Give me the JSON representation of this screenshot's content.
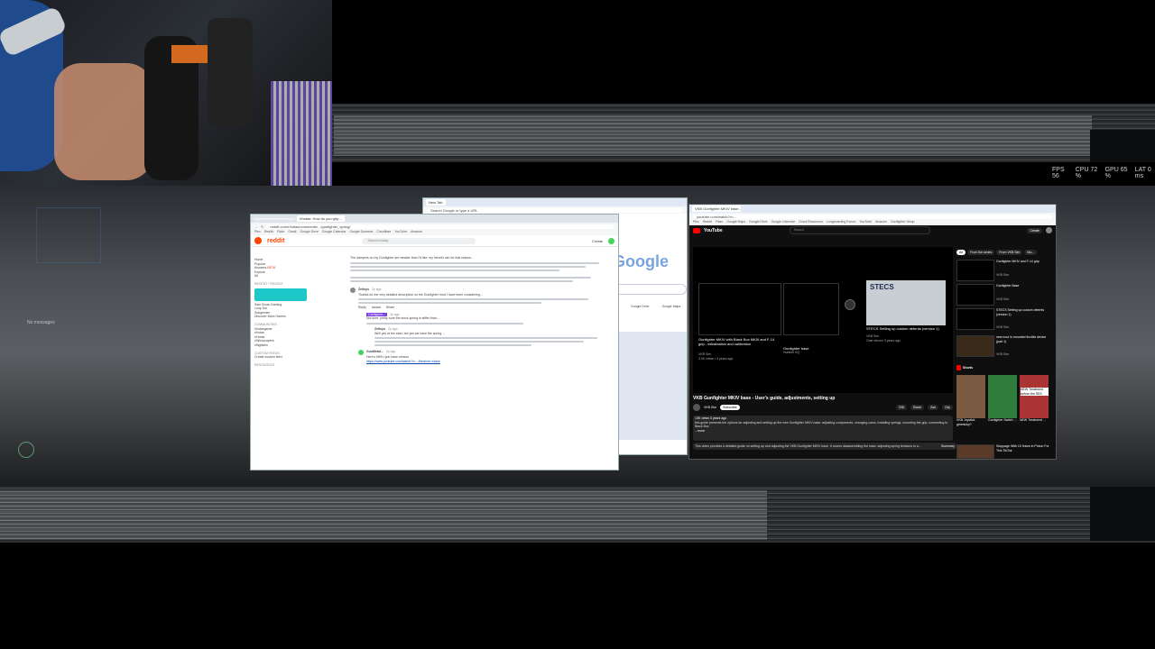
{
  "overlay": {
    "stats": [
      "FPS 56",
      "CPU 72 %",
      "GPU 65 %",
      "LAT 0 ms"
    ],
    "no_messages": "No messages"
  },
  "reddit_window": {
    "tabs": [
      "",
      "r/hotas: How do you grip..."
    ],
    "url": "reddit.com/r/hotas/comments/.../gunfighter_spring/",
    "bookmarks": [
      "Plex",
      "Reddit",
      "Flickr",
      "Gmail",
      "Google Drive",
      "Google Calendar",
      "Google Domains",
      "Cloudflare",
      "YouTube",
      "Amazon"
    ],
    "logo": "reddit",
    "search_placeholder": "Search r/hotas",
    "header_actions": [
      "Create"
    ],
    "sidebar": {
      "nav": [
        "Home",
        "Popular",
        "Answers",
        "Explore",
        "All"
      ],
      "answers_badge": "BETA",
      "recent_label": "RECENT / RECENT",
      "recent": [
        "Sam Snow Gaming",
        "Loop Dol",
        "Subgender",
        "Discover More Games"
      ],
      "communities_label": "COMMUNITIES",
      "communities": [
        "r/hotasgame",
        "r/hotas",
        "r/Hotas",
        "r/Winscrapers",
        "r/flightsim"
      ],
      "custom_feeds_label": "CUSTOM FEEDS",
      "custom_feeds": [
        "Create custom feed"
      ],
      "resources_label": "RESOURCES"
    },
    "comments": [
      {
        "user": "",
        "age": "",
        "text": "The dampers on my Gunfighter are weaker than I'd like; my friend's sim for that reason..."
      },
      {
        "user": "Zeltsys",
        "age": "2y ago",
        "text": "Thanks for the very detailed description on the Gunfighter mod I have been considering..."
      },
      {
        "user": "Gunfighter...",
        "age": "2y ago",
        "text": "Not sure; pretty sure the stock spring is stiffer than..."
      },
      {
        "user": "Zeltsys",
        "age": "2y ago",
        "text": "Well yes at the start, but yes we have the spring ..."
      },
      {
        "user": "GunMetal...",
        "age": "2y ago",
        "text": "Here's MKIV gun base version"
      }
    ],
    "link": "https://www.youtube.com/watch?v=...&feature=share",
    "comment_actions": [
      "Reply",
      "Award",
      "Share"
    ]
  },
  "google_window": {
    "tab": "New Tab",
    "search_placeholder": "Search Google or type a URL",
    "logo": "Google",
    "shortcuts": [
      "Google Drive",
      "Google Maps"
    ]
  },
  "youtube_window": {
    "tab": "VKB Gunfighter MKIV base...",
    "url": "youtube.com/watch?v=...",
    "bookmarks": [
      "Plex",
      "Reddit",
      "Flickr",
      "Google Maps",
      "Google Drive",
      "Google Calendar",
      "Cloud Resources",
      "Longboarding Forum",
      "YouTube",
      "Amazon",
      "Gunfighter Setup"
    ],
    "logo": "YouTube",
    "search_placeholder": "Search",
    "create_label": "Create",
    "player_cards": [
      {
        "title": "Gunfighter MKIV with Black Box MKIII and F-14 grip - initialization and calibration",
        "channel": "VKB Sim",
        "meta": "3.3K views • 3 years ago"
      },
      {
        "title": "Gunfighter base",
        "channel": "Hubbell HQ",
        "meta": ""
      },
      {
        "title": "STECS Setting up custom detents (version 1)",
        "channel": "VKB Sim",
        "meta": "Over eleven 3 years ago"
      }
    ],
    "thumbnail_text": "STECS",
    "video_title": "VKB Gunfighter MKIV base - User's guide, adjustments, setting up",
    "channel": "VKB Sim",
    "subscribe_label": "Subscribe",
    "actions": [
      "298",
      "Share",
      "Ask",
      "Clip"
    ],
    "description_meta": "13K views  3 years ago",
    "description": "this guide presents the options for adjusting and setting up the new Gunfighter MKIV base: adjusting components, changing cams, installing springs, mounting the grip, connecting to Black Box.",
    "more_label": "...more",
    "summary": "This video provides a detailed guide on setting up and adjusting the VKB Gunfighter MKIV base. It covers disassembling the base, adjusting spring tensions to a...",
    "summary_label": "Summary",
    "chips": [
      "All",
      "From the series",
      "From VKB Sim",
      "Ma..."
    ],
    "recommended": [
      {
        "title": "Gunfighter MKIV and F-14 grip",
        "channel": "VKB Sim"
      },
      {
        "title": "Gunfighter Base",
        "channel": "VKB Sim"
      },
      {
        "title": "STECS Setting up custom detents (version 1)",
        "channel": "VKB Sim"
      },
      {
        "title": "new mod in mounted throttle device (part 1)",
        "channel": "VKB Sim"
      }
    ],
    "shorts_label": "Shorts",
    "shorts": [
      {
        "title": "VKB Joystick gimmicky?",
        "views": ""
      },
      {
        "title": "Gunfighter Switch ...",
        "views": ""
      },
      {
        "title": "NEW Treatment ...",
        "views": ""
      }
    ],
    "short_overlay": "NEW Treatment before the SES",
    "bottom_rec": "Stoppage With 10 Halos in Prison For This TikTok"
  }
}
